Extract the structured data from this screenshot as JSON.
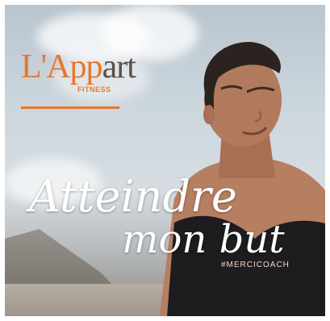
{
  "logo": {
    "initial": "L'App",
    "rest": "art",
    "sub": "FITNESS"
  },
  "headline": {
    "line1": "Atteindre",
    "line2": "mon but"
  },
  "hashtag": "#MERCICOACH",
  "colors": {
    "brand_orange": "#e9762b",
    "brand_gray": "#5b5048",
    "text_white": "#ffffff"
  }
}
